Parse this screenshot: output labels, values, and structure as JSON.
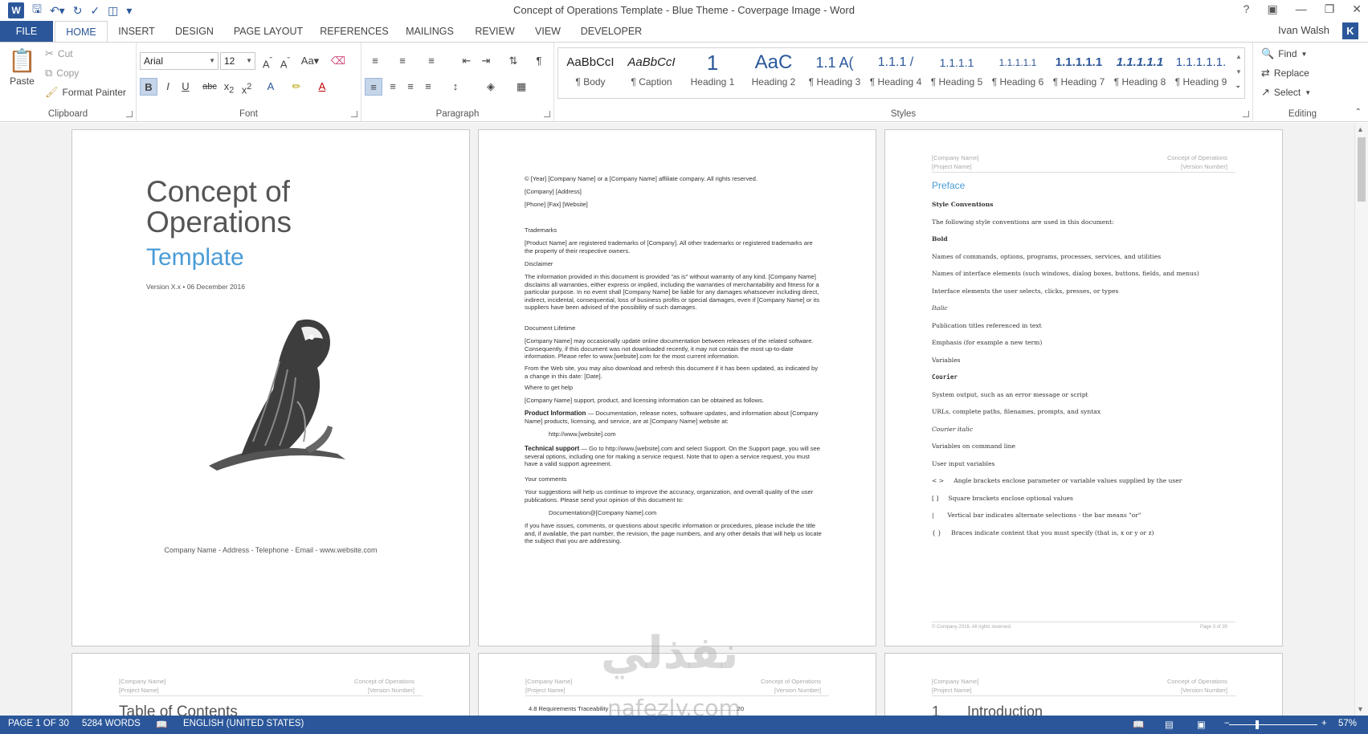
{
  "window": {
    "title": "Concept of Operations Template - Blue Theme - Coverpage Image - Word",
    "user_name": "Ivan Walsh",
    "user_initial": "K"
  },
  "quick_access": [
    "word-logo",
    "save-icon",
    "undo-icon",
    "redo-icon",
    "spelling-icon",
    "touch-mode-icon",
    "customize-icon"
  ],
  "tabs": [
    "FILE",
    "HOME",
    "INSERT",
    "DESIGN",
    "PAGE LAYOUT",
    "REFERENCES",
    "MAILINGS",
    "REVIEW",
    "VIEW",
    "DEVELOPER"
  ],
  "active_tab": "HOME",
  "ribbon": {
    "clipboard": {
      "label": "Clipboard",
      "paste": "Paste",
      "cut": "Cut",
      "copy": "Copy",
      "format_painter": "Format Painter"
    },
    "font": {
      "label": "Font",
      "name": "Arial",
      "size": "12"
    },
    "paragraph": {
      "label": "Paragraph"
    },
    "styles": {
      "label": "Styles",
      "items": [
        {
          "sample": "AaBbCcI",
          "name": "¶ Body"
        },
        {
          "sample": "AaBbCcI",
          "name": "¶ Caption"
        },
        {
          "sample": "1",
          "name": "Heading 1"
        },
        {
          "sample": "AaC",
          "name": "Heading 2"
        },
        {
          "sample": "1.1 A(",
          "name": "¶ Heading 3"
        },
        {
          "sample": "1.1.1 /",
          "name": "¶ Heading 4"
        },
        {
          "sample": "1.1.1.1",
          "name": "¶ Heading 5"
        },
        {
          "sample": "1.1.1.1.1",
          "name": "¶ Heading 6"
        },
        {
          "sample": "1.1.1.1.1",
          "name": "¶ Heading 7"
        },
        {
          "sample": "1.1.1.1.1",
          "name": "¶ Heading 8"
        },
        {
          "sample": "1.1.1.1.1.",
          "name": "¶ Heading 9"
        }
      ]
    },
    "editing": {
      "label": "Editing",
      "find": "Find",
      "replace": "Replace",
      "select": "Select"
    }
  },
  "cover": {
    "title_line1": "Concept of",
    "title_line2": "Operations",
    "subtitle": "Template",
    "version": "Version X.x • 06 December 2016",
    "footer": "Company Name - Address - Telephone - Email - www.website.com"
  },
  "page2": {
    "copyright": "© [Year] [Company Name] or a [Company Name] affiliate company. All rights reserved.",
    "address": "[Company] [Address]",
    "contact": "[Phone] [Fax] [Website]",
    "trademarks_h": "Trademarks",
    "trademarks": "[Product Name] are registered trademarks of [Company]. All other trademarks or registered trademarks are the property of their respective owners.",
    "disclaimer_h": "Disclaimer",
    "disclaimer": "The information provided in this document is provided \"as is\" without warranty of any kind. [Company Name] disclaims all warranties, either express or implied, including the warranties of merchantability and fitness for a particular purpose. In no event shall [Company Name] be liable for any damages whatsoever including direct, indirect, incidental, consequential, loss of business profits or special damages, even if [Company Name] or its suppliers have been advised of the possibility of such damages.",
    "lifetime_h": "Document Lifetime",
    "lifetime1": "[Company Name] may occasionally update online documentation between releases of the related software. Consequently, if this document was not downloaded recently, it may not contain the most up-to-date information. Please refer to www.[website].com for the most current information.",
    "lifetime2": "From the Web site, you may also download and refresh this document if it has been updated, as indicated by a change in this date: [Date].",
    "help_h": "Where to get help",
    "help": "[Company Name] support, product, and licensing information can be obtained as follows.",
    "product_h": "Product Information",
    "product": " — Documentation, release notes, software updates, and information about [Company Name] products, licensing, and service, are at [Company Name] website at:",
    "product_url": "http://www.[website].com",
    "tech_h": "Technical support",
    "tech": " — Go to http://www.[website].com and select Support. On the Support page, you will see several options, including one for making a service request. Note that to open a service request, you must have a valid support agreement.",
    "comments_h": "Your comments",
    "comments": "Your suggestions will help us continue to improve the accuracy, organization, and overall quality of the user publications. Please send your opinion of this document to:",
    "email": "Documentation@[Company Name].com",
    "issues": "If you have issues, comments, or questions about specific information or procedures, please include the title and, if available, the part number, the revision, the page numbers, and any other details that will help us locate the subject that you are addressing."
  },
  "page3": {
    "hdr_left1": "[Company Name]",
    "hdr_left2": "[Project Name]",
    "hdr_right1": "Concept of Operations",
    "hdr_right2": "[Version Number]",
    "preface": "Preface",
    "lines": [
      {
        "t": "Style Conventions",
        "s": "b"
      },
      {
        "t": "The following style conventions are used in this document:",
        "s": ""
      },
      {
        "t": "Bold",
        "s": "b"
      },
      {
        "t": "Names of commands, options, programs, processes, services, and utilities",
        "s": ""
      },
      {
        "t": "Names of interface elements (such windows, dialog boxes, buttons, fields, and menus)",
        "s": ""
      },
      {
        "t": "Interface elements the user selects, clicks, presses, or types",
        "s": ""
      },
      {
        "t": "Italic",
        "s": "i"
      },
      {
        "t": "Publication titles referenced in text",
        "s": ""
      },
      {
        "t": "Emphasis (for example a new term)",
        "s": ""
      },
      {
        "t": "Variables",
        "s": ""
      },
      {
        "t": "Courier",
        "s": "m"
      },
      {
        "t": "System output, such as an error message or script",
        "s": ""
      },
      {
        "t": "URLs, complete paths, filenames, prompts, and syntax",
        "s": ""
      },
      {
        "t": "Courier italic",
        "s": "i"
      },
      {
        "t": "Variables on command line",
        "s": ""
      },
      {
        "t": "User input variables",
        "s": ""
      },
      {
        "t": "< >     Angle brackets enclose parameter or variable values supplied by the user",
        "s": ""
      },
      {
        "t": "[ ]     Square brackets enclose optional values",
        "s": ""
      },
      {
        "t": "|       Vertical bar indicates alternate selections - the bar means \"or\"",
        "s": ""
      },
      {
        "t": "{ }     Braces indicate content that you must specify (that is, x or y or z)",
        "s": ""
      }
    ],
    "footer_left": "© Company 2016. All rights reserved.",
    "footer_right": "Page 3 of 30"
  },
  "row2": {
    "p4_heading": "Table of Contents",
    "p5_line": "4.8      Requirements Traceability ............................................................................20",
    "p6_num": "1",
    "p6_heading": "Introduction"
  },
  "watermark": {
    "arabic": "نفذلي",
    "latin": "nafezly.com"
  },
  "status": {
    "page": "PAGE 1 OF 30",
    "words": "5284 WORDS",
    "language": "ENGLISH (UNITED STATES)",
    "zoom": "57%"
  }
}
